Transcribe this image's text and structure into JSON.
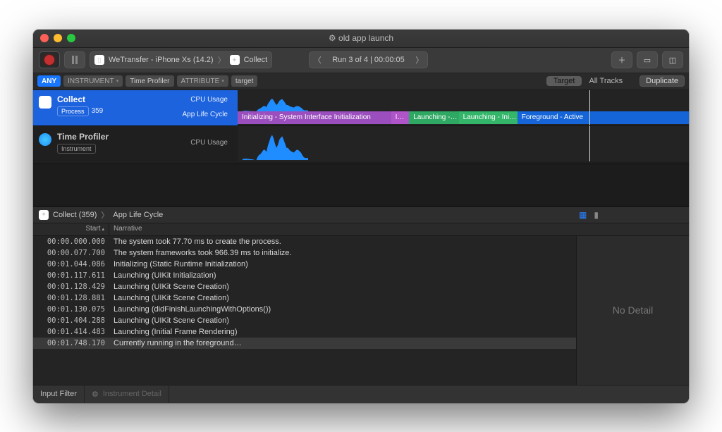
{
  "title": "old app launch",
  "titlePrefix": "⚙︎",
  "toolbar": {
    "path_app": "WeTransfer - iPhone Xs (14.2)",
    "path_target": "Collect",
    "run_label": "Run 3 of 4  |  00:00:05"
  },
  "filterbar": {
    "any": "ANY",
    "instrument_label": "INSTRUMENT",
    "instrument_value": "Time Profiler",
    "attribute_label": "ATTRIBUTE",
    "target_label": "target",
    "seg_target": "Target",
    "all_tracks": "All Tracks",
    "duplicate": "Duplicate"
  },
  "tracks": {
    "collect": {
      "title": "Collect",
      "tag": "Process",
      "pid": "359",
      "row1": "CPU Usage",
      "row2": "App Life Cycle"
    },
    "profiler": {
      "title": "Time Profiler",
      "tag": "Instrument",
      "row": "CPU Usage"
    },
    "lifecycle": [
      {
        "label": "Initializing - System Interface Initialization",
        "cls": "lc-purple",
        "w": 34
      },
      {
        "label": "I…",
        "cls": "lc-purple2",
        "w": 4
      },
      {
        "label": "Launching -…",
        "cls": "lc-green",
        "w": 11
      },
      {
        "label": "Launching - Ini…",
        "cls": "lc-green2",
        "w": 13
      },
      {
        "label": "Foreground - Active",
        "cls": "lc-blue",
        "w": 38
      }
    ]
  },
  "detail": {
    "crumb_app": "Collect (359)",
    "crumb_view": "App Life Cycle",
    "col_start": "Start",
    "col_narr": "Narrative",
    "no_detail": "No Detail",
    "rows": [
      {
        "t": "00:00.000.000",
        "n": "The system took 77.70 ms to create the process."
      },
      {
        "t": "00:00.077.700",
        "n": "The system frameworks took 966.39 ms to initialize."
      },
      {
        "t": "00:01.044.086",
        "n": "Initializing (Static Runtime Initialization)"
      },
      {
        "t": "00:01.117.611",
        "n": "Launching (UIKit Initialization)"
      },
      {
        "t": "00:01.128.429",
        "n": "Launching (UIKit Scene Creation)"
      },
      {
        "t": "00:01.128.881",
        "n": "Launching (UIKit Scene Creation)"
      },
      {
        "t": "00:01.130.075",
        "n": "Launching (didFinishLaunchingWithOptions())"
      },
      {
        "t": "00:01.404.288",
        "n": "Launching (UIKit Scene Creation)"
      },
      {
        "t": "00:01.414.483",
        "n": "Launching (Initial Frame Rendering)"
      },
      {
        "t": "00:01.748.170",
        "n": "Currently running in the foreground…",
        "hl": true
      }
    ]
  },
  "footer": {
    "input_filter": "Input Filter",
    "instrument_detail": "Instrument Detail"
  },
  "chart_data": [
    {
      "type": "area",
      "title": "Collect — CPU Usage",
      "x_domain_s": [
        0,
        5
      ],
      "ylabel": "CPU Usage",
      "values_pct": [
        0,
        0,
        0,
        0,
        2,
        3,
        3,
        2,
        2,
        1,
        1,
        1,
        0,
        0,
        8,
        12,
        15,
        20,
        25,
        25,
        20,
        35,
        45,
        55,
        60,
        52,
        40,
        30,
        38,
        50,
        55,
        58,
        50,
        40,
        30,
        30,
        25,
        22,
        20,
        18,
        22,
        25,
        25,
        22,
        18,
        12,
        6,
        5,
        5,
        5
      ]
    },
    {
      "type": "area",
      "title": "Time Profiler — CPU Usage",
      "x_domain_s": [
        0,
        5
      ],
      "ylabel": "CPU Usage",
      "values_pct": [
        0,
        0,
        0,
        0,
        3,
        4,
        4,
        3,
        3,
        2,
        2,
        1,
        0,
        0,
        10,
        15,
        18,
        24,
        30,
        30,
        24,
        42,
        55,
        68,
        74,
        64,
        48,
        36,
        45,
        60,
        66,
        70,
        60,
        48,
        36,
        36,
        30,
        26,
        24,
        22,
        26,
        30,
        30,
        26,
        22,
        14,
        8,
        6,
        6,
        6
      ]
    }
  ]
}
